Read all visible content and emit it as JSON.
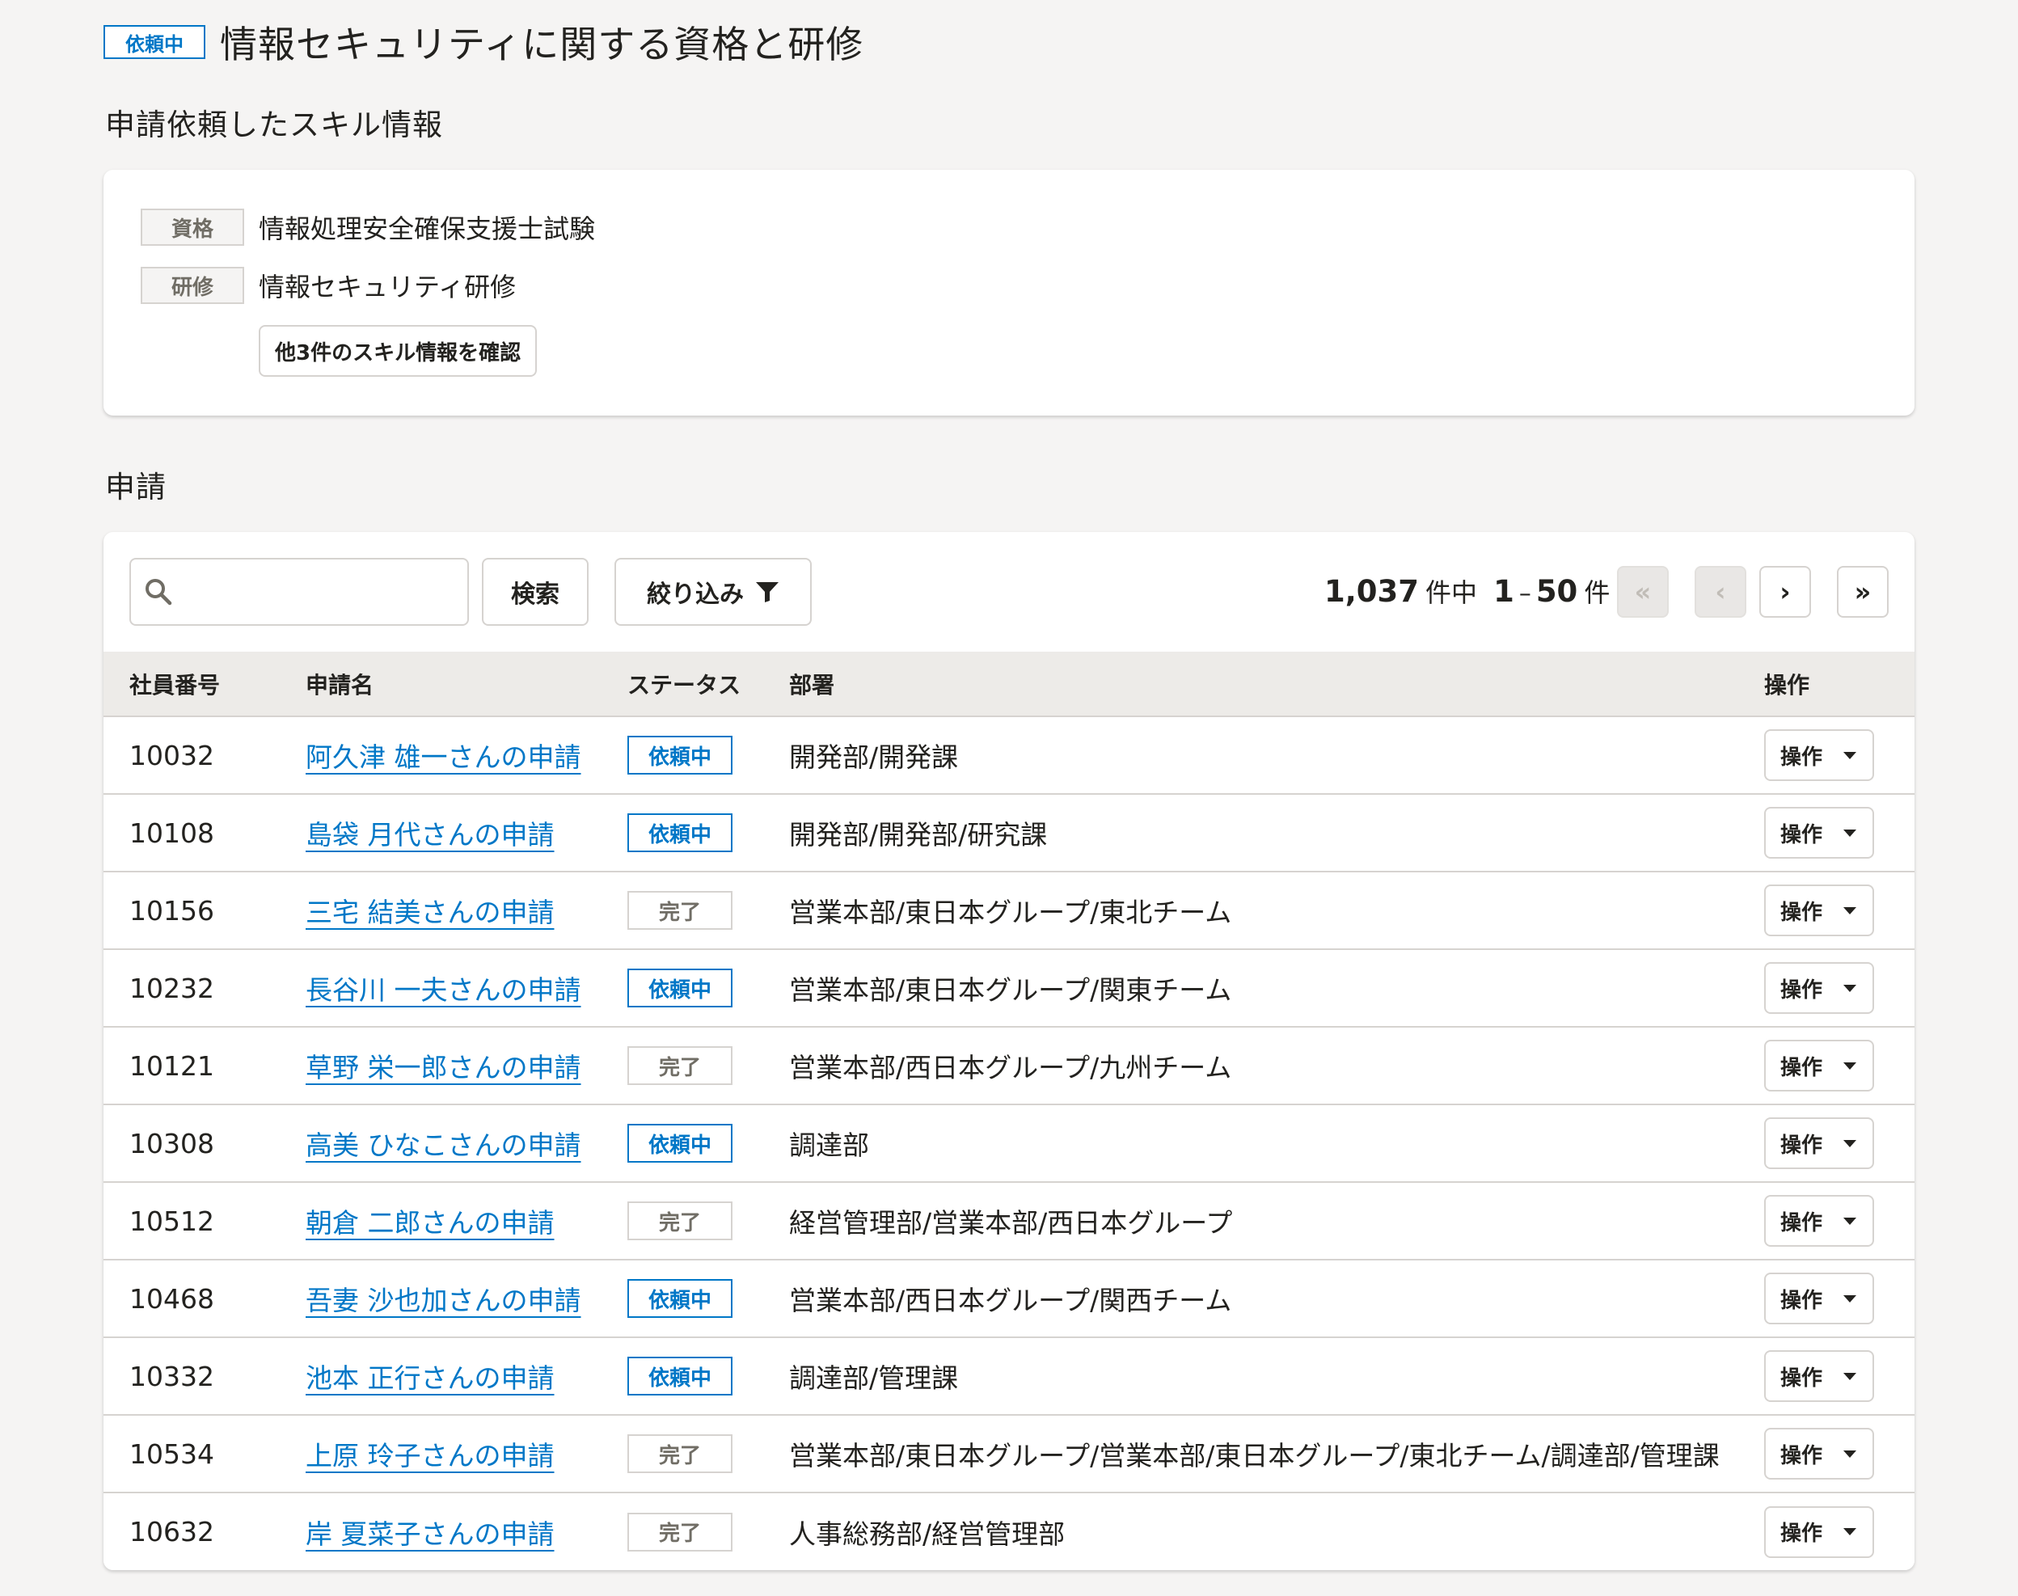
{
  "header": {
    "status_badge": "依頼中",
    "title": "情報セキュリティに関する資格と研修"
  },
  "skill_section": {
    "title": "申請依頼したスキル情報",
    "items": [
      {
        "tag": "資格",
        "name": "情報処理安全確保支援士試験"
      },
      {
        "tag": "研修",
        "name": "情報セキュリティ研修"
      }
    ],
    "more_button": "他3件のスキル情報を確認"
  },
  "applications": {
    "title": "申請",
    "search": {
      "placeholder": "",
      "button": "検索"
    },
    "filter_button": "絞り込み",
    "pagination": {
      "total": "1,037",
      "unit_total": "件中",
      "range_start": "1",
      "sep": "–",
      "range_end": "50",
      "unit": "件",
      "first": "«",
      "prev": "‹",
      "next": "›",
      "last": "»"
    },
    "columns": [
      "社員番号",
      "申請名",
      "ステータス",
      "部署",
      "操作"
    ],
    "rows": [
      {
        "id": "10032",
        "name": "阿久津 雄一さんの申請",
        "status": "依頼中",
        "dept": "開発部/開発課",
        "action": "操作"
      },
      {
        "id": "10108",
        "name": "島袋 月代さんの申請",
        "status": "依頼中",
        "dept": "開発部/開発部/研究課",
        "action": "操作"
      },
      {
        "id": "10156",
        "name": "三宅 結美さんの申請",
        "status": "完了",
        "dept": "営業本部/東日本グループ/東北チーム",
        "action": "操作"
      },
      {
        "id": "10232",
        "name": "長谷川 一夫さんの申請",
        "status": "依頼中",
        "dept": "営業本部/東日本グループ/関東チーム",
        "action": "操作"
      },
      {
        "id": "10121",
        "name": "草野 栄一郎さんの申請",
        "status": "完了",
        "dept": "営業本部/西日本グループ/九州チーム",
        "action": "操作"
      },
      {
        "id": "10308",
        "name": "高美 ひなこさんの申請",
        "status": "依頼中",
        "dept": "調達部",
        "action": "操作"
      },
      {
        "id": "10512",
        "name": "朝倉 二郎さんの申請",
        "status": "完了",
        "dept": "経営管理部/営業本部/西日本グループ",
        "action": "操作"
      },
      {
        "id": "10468",
        "name": "吾妻 沙也加さんの申請",
        "status": "依頼中",
        "dept": "営業本部/西日本グループ/関西チーム",
        "action": "操作"
      },
      {
        "id": "10332",
        "name": "池本 正行さんの申請",
        "status": "依頼中",
        "dept": "調達部/管理課",
        "action": "操作"
      },
      {
        "id": "10534",
        "name": "上原 玲子さんの申請",
        "status": "完了",
        "dept": "営業本部/東日本グループ/営業本部/東日本グループ/東北チーム/調達部/管理課",
        "action": "操作"
      },
      {
        "id": "10632",
        "name": "岸 夏菜子さんの申請",
        "status": "完了",
        "dept": "人事総務部/経営管理部",
        "action": "操作"
      }
    ]
  },
  "colors": {
    "accent": "#0077c7",
    "background": "#f5f4f3",
    "border": "#d6d3d0",
    "header_row": "#edebe8"
  }
}
